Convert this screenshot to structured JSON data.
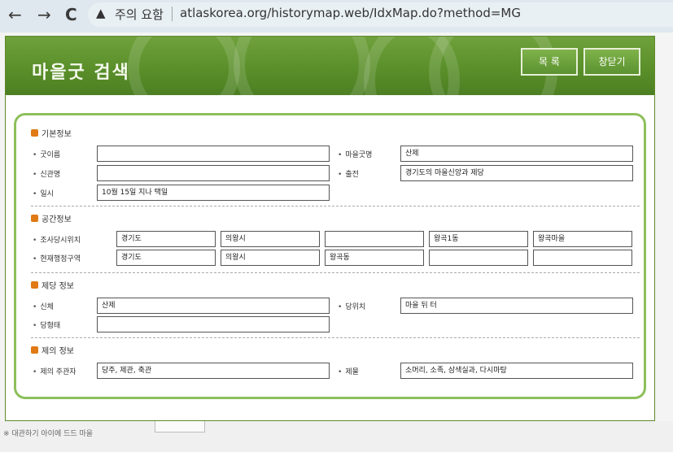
{
  "browser": {
    "back_icon": "←",
    "forward_icon": "→",
    "reload_icon": "C",
    "warning_icon": "▲",
    "warning_text": "주의 요함",
    "url": "atlaskorea.org/historymap.web/IdxMap.do?method=MG"
  },
  "popup": {
    "title": "마을굿 검색",
    "list_button": "목 록",
    "close_button": "창닫기"
  },
  "sections": {
    "basic": {
      "title": "기본정보",
      "name_label": "굿이름",
      "name_value": "",
      "village_rite_label": "마을굿명",
      "village_rite_value": "산제",
      "deity_label": "신관명",
      "deity_value": "",
      "source_label": "출전",
      "source_value": "경기도의 마을신앙과 제당",
      "date_label": "일시",
      "date_value": "10월 15일 지나 택일"
    },
    "location": {
      "title": "공간정보",
      "survey_label": "조사당시위치",
      "survey_values": [
        "경기도",
        "의왕시",
        "",
        "왕곡1동",
        "왕곡마을"
      ],
      "admin_label": "현재행정구역",
      "admin_values": [
        "경기도",
        "의왕시",
        "왕곡동",
        "",
        ""
      ]
    },
    "shrine": {
      "title": "제당 정보",
      "name_label": "신체",
      "name_value": "산제",
      "position_label": "당위치",
      "position_value": "마을 뒤 터",
      "form_label": "당형태",
      "form_value": ""
    },
    "ritual": {
      "title": "제의 정보",
      "participants_label": "제의 주관자",
      "participants_value": "당주, 제관, 축관",
      "offerings_label": "제물",
      "offerings_value": "소머리, 소족, 삼색실과, 다시마탕"
    }
  },
  "background": {
    "footer_text": "※ 대관하기 아이에 드드 마을"
  }
}
